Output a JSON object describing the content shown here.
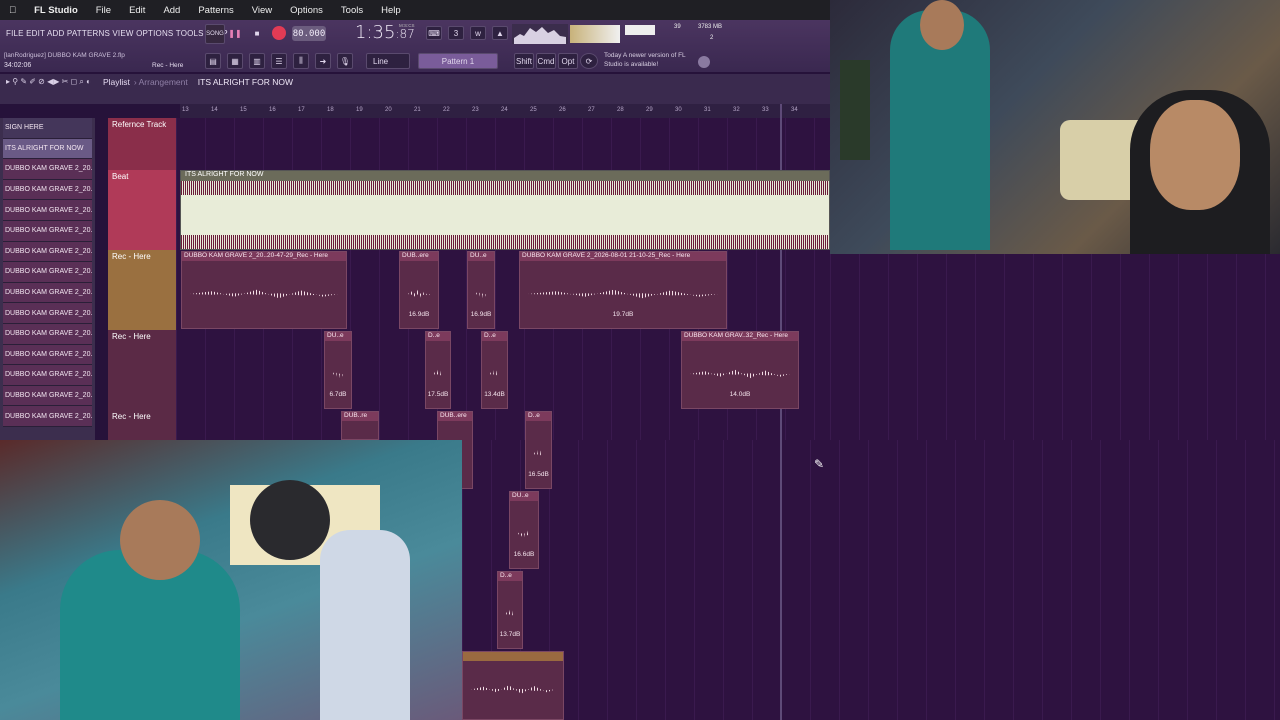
{
  "mac_menu": {
    "apple": "",
    "app": "FL Studio",
    "items": [
      "File",
      "Edit",
      "Add",
      "Patterns",
      "View",
      "Options",
      "Tools",
      "Help"
    ]
  },
  "toolbar": {
    "menus": "FILE  EDIT  ADD  PATTERNS  VIEW  OPTIONS  TOOLS  HELP",
    "project": "[lanRodriguez] DUBBO KAM GRAVE 2.flp",
    "time_small": "34:02:06",
    "hint": "Rec - Here",
    "song_label": "SONG",
    "tempo": "80.000",
    "time": "1:35",
    "time_sub": ":87",
    "time_units": "M:S:CS",
    "cpu": "39",
    "mem": "3783 MB",
    "mem2": "2",
    "snap": "Line",
    "pattern": "Pattern 1",
    "shift": "Shift",
    "cmd": "Cmd",
    "opt": "Opt",
    "news_date": "Today",
    "news": "A newer version of FL Studio is available!"
  },
  "playlist": {
    "title": "Playlist",
    "sep": "› Arrangement",
    "song": "ITS ALRIGHT FOR NOW",
    "ruler": [
      "13",
      "14",
      "15",
      "16",
      "17",
      "18",
      "19",
      "20",
      "21",
      "22",
      "23",
      "24",
      "25",
      "26",
      "27",
      "28",
      "29",
      "30",
      "31",
      "32",
      "33",
      "34"
    ]
  },
  "patterns": [
    "SIGN HERE",
    "ITS ALRIGHT FOR NOW",
    "DUBBO KAM GRAVE 2_20...",
    "DUBBO KAM GRAVE 2_20...",
    "DUBBO KAM GRAVE 2_20...",
    "DUBBO KAM GRAVE 2_20...",
    "DUBBO KAM GRAVE 2_20...",
    "DUBBO KAM GRAVE 2_20...",
    "DUBBO KAM GRAVE 2_20...",
    "DUBBO KAM GRAVE 2_20...",
    "DUBBO KAM GRAVE 2_20...",
    "DUBBO KAM GRAVE 2_20...",
    "DUBBO KAM GRAVE 2_20...",
    "DUBBO KAM GRAVE 2_20...",
    "DUBBO KAM GRAVE 2_20..."
  ],
  "tracks": [
    "Refernce Track",
    "Beat",
    "Rec - Here",
    "Rec - Here",
    "Rec - Here"
  ],
  "beat_clip": "ITS ALRIGHT FOR NOW",
  "clips": {
    "c1": {
      "title": "DUBBO KAM GRAVE 2_20..20-47-29_Rec - Here",
      "db": ""
    },
    "c2": {
      "title": "DUB..ere",
      "db": "16.9dB"
    },
    "c3": {
      "title": "DU..e",
      "db": "16.9dB"
    },
    "c4": {
      "title": "DUBBO KAM GRAVE 2_2026-08-01 21-10-25_Rec - Here",
      "db": "19.7dB"
    },
    "c5": {
      "title": "DU..e",
      "db": "6.7dB"
    },
    "c6": {
      "title": "D..e",
      "db": "17.5dB"
    },
    "c7": {
      "title": "D..e",
      "db": "13.4dB"
    },
    "c8": {
      "title": "DUBBO KAM GRAV..32_Rec - Here",
      "db": "14.0dB"
    },
    "c9": {
      "title": "DUB..re",
      "db": ""
    },
    "c10": {
      "title": "DUB..ere",
      "db": ""
    },
    "c11": {
      "title": "D..e",
      "db": "16.5dB"
    },
    "c12": {
      "title": "DU..e",
      "db": "16.6dB"
    },
    "c13": {
      "title": "D..e",
      "db": "13.7dB"
    }
  }
}
